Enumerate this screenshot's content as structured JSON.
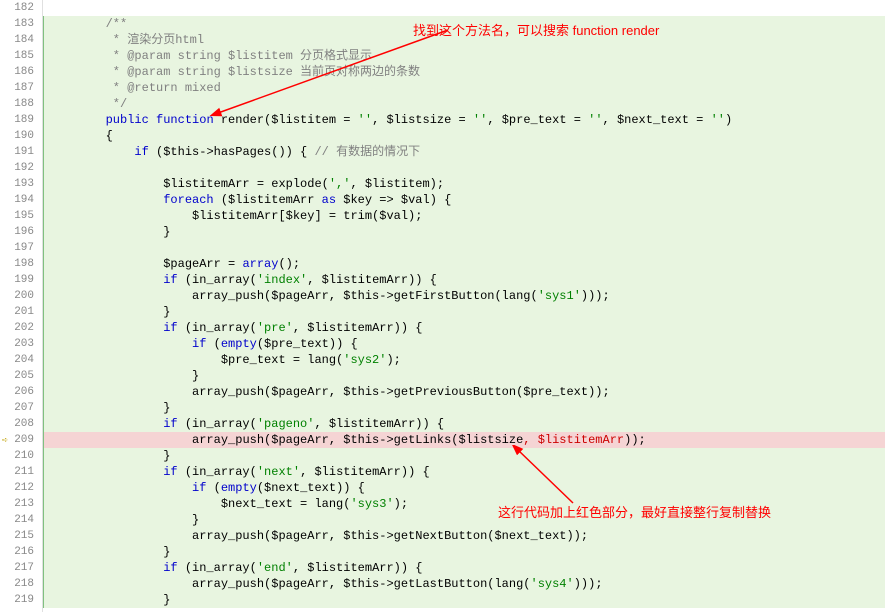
{
  "annotations": {
    "top": "找到这个方法名，可以搜索 function render",
    "bottom": "这行代码加上红色部分，最好直接整行复制替换"
  },
  "lines": [
    {
      "num": 182,
      "indent": 1,
      "text": "",
      "first": true
    },
    {
      "num": 183,
      "indent": 2,
      "text": "/**",
      "comment": true
    },
    {
      "num": 184,
      "indent": 2,
      "text": " * 渲染分页html",
      "comment": true
    },
    {
      "num": 185,
      "indent": 2,
      "text": " * @param string $listitem 分页格式显示",
      "comment": true
    },
    {
      "num": 186,
      "indent": 2,
      "text": " * @param string $listsize 当前页对称两边的条数",
      "comment": true
    },
    {
      "num": 187,
      "indent": 2,
      "text": " * @return mixed",
      "comment": true
    },
    {
      "num": 188,
      "indent": 2,
      "text": " */",
      "comment": true
    },
    {
      "num": 189,
      "indent": 2,
      "parts": [
        {
          "t": "public",
          "c": "keyword"
        },
        {
          "t": " "
        },
        {
          "t": "function",
          "c": "keyword"
        },
        {
          "t": " render($listitem = "
        },
        {
          "t": "''",
          "c": "string"
        },
        {
          "t": ", $listsize = "
        },
        {
          "t": "''",
          "c": "string"
        },
        {
          "t": ", $pre_text = "
        },
        {
          "t": "''",
          "c": "string"
        },
        {
          "t": ", $next_text = "
        },
        {
          "t": "''",
          "c": "string"
        },
        {
          "t": ")"
        }
      ]
    },
    {
      "num": 190,
      "indent": 2,
      "text": "{"
    },
    {
      "num": 191,
      "indent": 3,
      "parts": [
        {
          "t": "if",
          "c": "keyword"
        },
        {
          "t": " ($this->hasPages()) { "
        },
        {
          "t": "// 有数据的情况下",
          "c": "comment"
        }
      ]
    },
    {
      "num": 192,
      "indent": 0,
      "text": ""
    },
    {
      "num": 193,
      "indent": 4,
      "parts": [
        {
          "t": "$listitemArr = explode("
        },
        {
          "t": "','",
          "c": "string"
        },
        {
          "t": ", $listitem);"
        }
      ]
    },
    {
      "num": 194,
      "indent": 4,
      "parts": [
        {
          "t": "foreach",
          "c": "keyword"
        },
        {
          "t": " ($listitemArr "
        },
        {
          "t": "as",
          "c": "keyword"
        },
        {
          "t": " $key => $val) {"
        }
      ]
    },
    {
      "num": 195,
      "indent": 5,
      "text": "$listitemArr[$key] = trim($val);"
    },
    {
      "num": 196,
      "indent": 4,
      "text": "}"
    },
    {
      "num": 197,
      "indent": 0,
      "text": ""
    },
    {
      "num": 198,
      "indent": 4,
      "parts": [
        {
          "t": "$pageArr = "
        },
        {
          "t": "array",
          "c": "keyword"
        },
        {
          "t": "();"
        }
      ]
    },
    {
      "num": 199,
      "indent": 4,
      "parts": [
        {
          "t": "if",
          "c": "keyword"
        },
        {
          "t": " (in_array("
        },
        {
          "t": "'index'",
          "c": "string"
        },
        {
          "t": ", $listitemArr)) {"
        }
      ]
    },
    {
      "num": 200,
      "indent": 5,
      "parts": [
        {
          "t": "array_push($pageArr, $this->getFirstButton(lang("
        },
        {
          "t": "'sys1'",
          "c": "string"
        },
        {
          "t": ")));"
        }
      ]
    },
    {
      "num": 201,
      "indent": 4,
      "text": "}"
    },
    {
      "num": 202,
      "indent": 4,
      "parts": [
        {
          "t": "if",
          "c": "keyword"
        },
        {
          "t": " (in_array("
        },
        {
          "t": "'pre'",
          "c": "string"
        },
        {
          "t": ", $listitemArr)) {"
        }
      ]
    },
    {
      "num": 203,
      "indent": 5,
      "parts": [
        {
          "t": "if",
          "c": "keyword"
        },
        {
          "t": " ("
        },
        {
          "t": "empty",
          "c": "keyword"
        },
        {
          "t": "($pre_text)) {"
        }
      ]
    },
    {
      "num": 204,
      "indent": 6,
      "parts": [
        {
          "t": "$pre_text = lang("
        },
        {
          "t": "'sys2'",
          "c": "string"
        },
        {
          "t": ");"
        }
      ]
    },
    {
      "num": 205,
      "indent": 5,
      "text": "}"
    },
    {
      "num": 206,
      "indent": 5,
      "text": "array_push($pageArr, $this->getPreviousButton($pre_text));"
    },
    {
      "num": 207,
      "indent": 4,
      "text": "}"
    },
    {
      "num": 208,
      "indent": 4,
      "parts": [
        {
          "t": "if",
          "c": "keyword"
        },
        {
          "t": " (in_array("
        },
        {
          "t": "'pageno'",
          "c": "string"
        },
        {
          "t": ", $listitemArr)) {"
        }
      ]
    },
    {
      "num": 209,
      "indent": 5,
      "highlighted": true,
      "marker": true,
      "parts": [
        {
          "t": "array_push($pageArr, $this->getLinks($listsize"
        },
        {
          "t": ", $listitemArr",
          "c": "red-text"
        },
        {
          "t": "));"
        }
      ]
    },
    {
      "num": 210,
      "indent": 4,
      "text": "}"
    },
    {
      "num": 211,
      "indent": 4,
      "parts": [
        {
          "t": "if",
          "c": "keyword"
        },
        {
          "t": " (in_array("
        },
        {
          "t": "'next'",
          "c": "string"
        },
        {
          "t": ", $listitemArr)) {"
        }
      ]
    },
    {
      "num": 212,
      "indent": 5,
      "parts": [
        {
          "t": "if",
          "c": "keyword"
        },
        {
          "t": " ("
        },
        {
          "t": "empty",
          "c": "keyword"
        },
        {
          "t": "($next_text)) {"
        }
      ]
    },
    {
      "num": 213,
      "indent": 6,
      "parts": [
        {
          "t": "$next_text = lang("
        },
        {
          "t": "'sys3'",
          "c": "string"
        },
        {
          "t": ");"
        }
      ]
    },
    {
      "num": 214,
      "indent": 5,
      "text": "}"
    },
    {
      "num": 215,
      "indent": 5,
      "text": "array_push($pageArr, $this->getNextButton($next_text));"
    },
    {
      "num": 216,
      "indent": 4,
      "text": "}"
    },
    {
      "num": 217,
      "indent": 4,
      "parts": [
        {
          "t": "if",
          "c": "keyword"
        },
        {
          "t": " (in_array("
        },
        {
          "t": "'end'",
          "c": "string"
        },
        {
          "t": ", $listitemArr)) {"
        }
      ]
    },
    {
      "num": 218,
      "indent": 5,
      "parts": [
        {
          "t": "array_push($pageArr, $this->getLastButton(lang("
        },
        {
          "t": "'sys4'",
          "c": "string"
        },
        {
          "t": ")));"
        }
      ]
    },
    {
      "num": 219,
      "indent": 4,
      "text": "}"
    }
  ]
}
